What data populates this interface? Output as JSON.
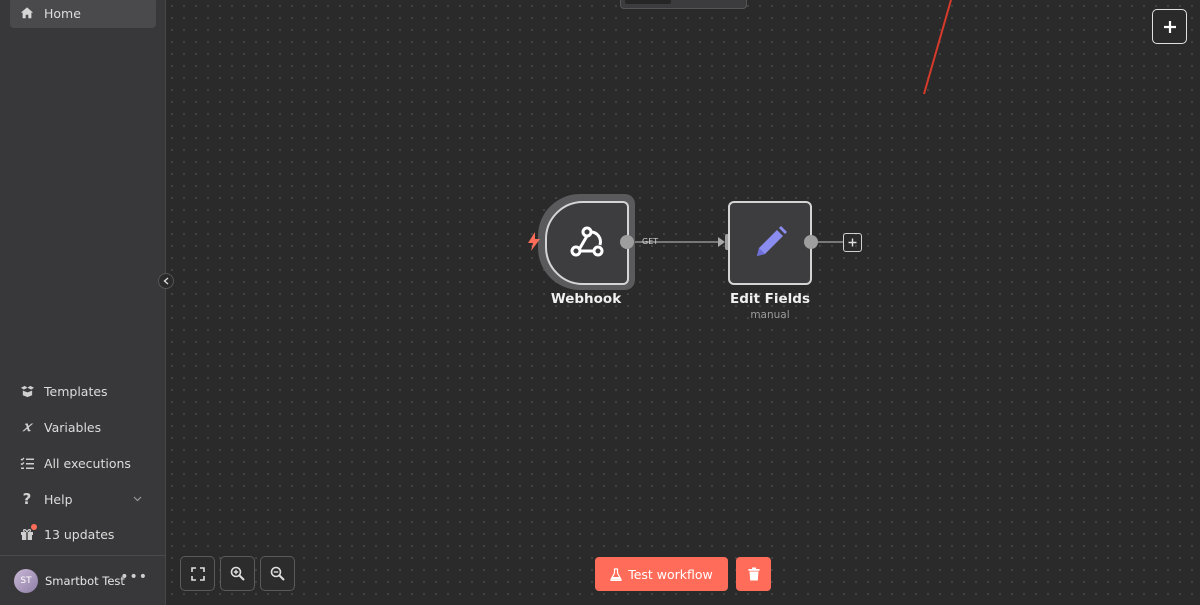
{
  "sidebar": {
    "home_label": "Home",
    "items": [
      {
        "label": "Templates",
        "icon": "box-open-icon"
      },
      {
        "label": "Variables",
        "icon": "variable-icon"
      },
      {
        "label": "All executions",
        "icon": "tasks-list-icon"
      },
      {
        "label": "Help",
        "icon": "question-icon"
      },
      {
        "label": "13 updates",
        "icon": "gift-icon"
      }
    ],
    "user": {
      "initials": "ST",
      "name": "Smartbot Test",
      "menu": "•••"
    }
  },
  "canvas": {
    "nodes": [
      {
        "title": "Webhook",
        "subtitle": "",
        "icon": "webhook-icon"
      },
      {
        "title": "Edit Fields",
        "subtitle": "manual",
        "icon": "pencil-icon"
      }
    ],
    "connection_label": "GET"
  },
  "footer": {
    "test_workflow_label": "Test workflow"
  },
  "colors": {
    "accent": "#ff6d5a",
    "canvas_bg": "#2a2a2a",
    "sidebar_bg": "#38383a",
    "edit_icon": "#8b8cf0"
  }
}
